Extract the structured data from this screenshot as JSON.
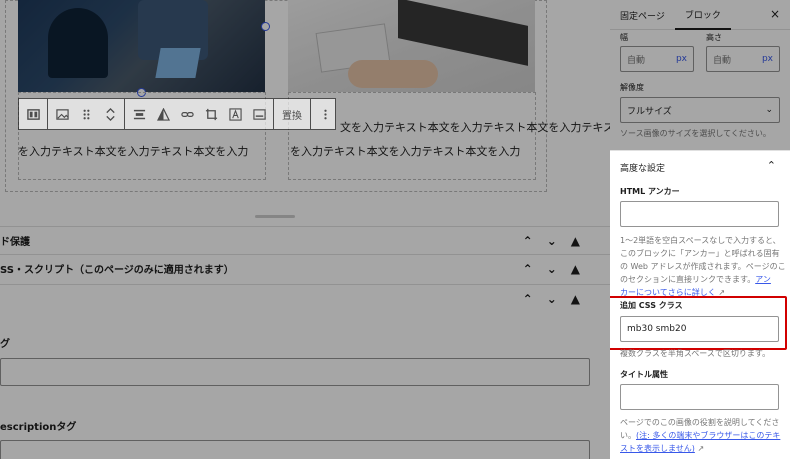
{
  "editor": {
    "body_text_right_line1": "文を入力テキスト本文を入力テキスト本文を入力テキスト",
    "body_text_left_line2": "を入力テキスト本文を入力テキスト本文を入力",
    "body_text_right_line2": "を入力テキスト本文を入力テキスト本文を入力"
  },
  "toolbar": {
    "replace_label": "置換",
    "icons": [
      "columns-icon",
      "image-icon",
      "drag-handle-icon",
      "move-updown-icon",
      "align-icon",
      "duotone-icon",
      "link-icon",
      "crop-icon",
      "text-overlay-icon",
      "caption-icon",
      "more-options-icon"
    ]
  },
  "panels": [
    {
      "label": "ド保護"
    },
    {
      "label": "SS・スクリプト（このページのみに適用されます）"
    },
    {
      "label": ""
    }
  ],
  "fields": [
    {
      "label": "グ"
    },
    {
      "label": "escriptionタグ"
    }
  ],
  "sidebar": {
    "tabs": [
      "固定ページ",
      "ブロック"
    ],
    "close_label": "×",
    "width_label": "幅",
    "height_label": "高さ",
    "width_value": "自動",
    "height_value": "自動",
    "unit": "px",
    "resolution_label": "解像度",
    "resolution_value": "フルサイズ",
    "resolution_help": "ソース画像のサイズを選択してください。",
    "advanced_title": "高度な設定",
    "html_anchor_label": "HTML アンカー",
    "html_anchor_value": "",
    "anchor_help_1": "1〜2単語を空白スペースなしで入力すると、",
    "anchor_help_2": "このブロックに「アンカー」と呼ばれる固有",
    "anchor_help_3": "の Web アドレスが作成されます。ページのこ",
    "anchor_help_4": "のセクションに直接リンクできます。",
    "anchor_link_1": "アン",
    "anchor_link_2": "カーについてさらに詳しく",
    "css_class_label": "追加 CSS クラス",
    "css_class_value": "mb30 smb20",
    "css_class_help": "複数クラスを半角スペースで区切ります。",
    "title_attr_label": "タイトル属性",
    "title_attr_value": "",
    "title_help_1": "ページでのこの画像の役割を説明してくださ",
    "title_help_2": "い。",
    "title_link_1": "(注: 多くの端末やブラウザーはこのテキ",
    "title_link_2": "ストを表示しません)"
  },
  "colors": {
    "accent": "#3858e9",
    "highlight": "#d10000"
  }
}
